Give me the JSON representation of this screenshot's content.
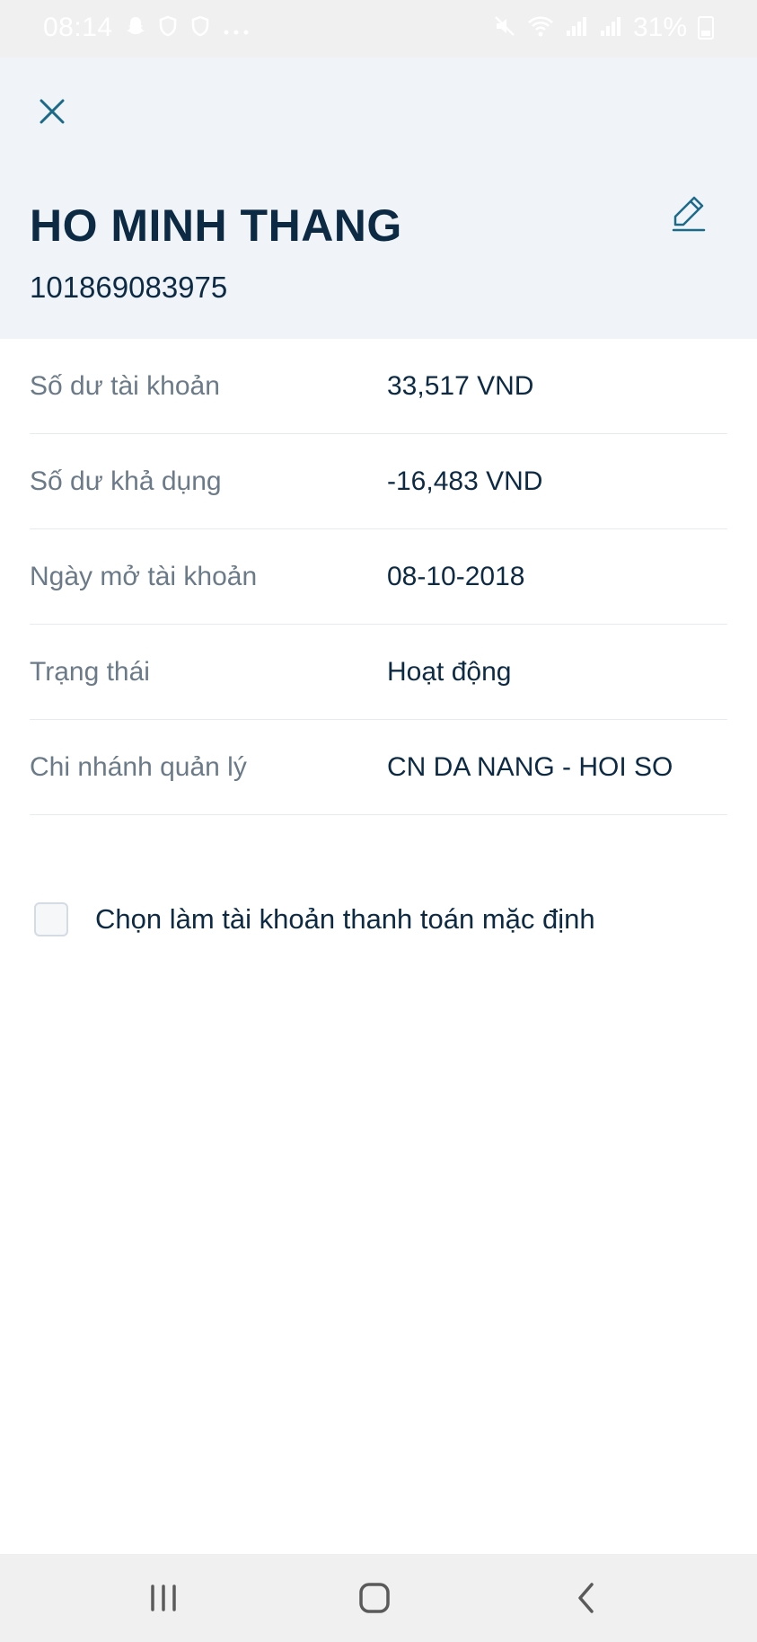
{
  "status_bar": {
    "time": "08:14",
    "battery": "31%",
    "left_icons": [
      "snapchat-icon",
      "shield-icon",
      "shield-icon",
      "more-dots-icon"
    ],
    "right_icons": [
      "mute-icon",
      "wifi-icon",
      "signal-icon",
      "signal-icon",
      "battery-icon"
    ]
  },
  "header": {
    "account_name": "HO MINH THANG",
    "account_number": "101869083975"
  },
  "details": [
    {
      "label": "Số dư tài khoản",
      "value": "33,517 VND"
    },
    {
      "label": "Số dư khả dụng",
      "value": "-16,483 VND"
    },
    {
      "label": "Ngày mở tài khoản",
      "value": "08-10-2018"
    },
    {
      "label": "Trạng thái",
      "value": "Hoạt động"
    },
    {
      "label": "Chi nhánh quản lý",
      "value": "CN DA NANG - HOI SO"
    }
  ],
  "default_account": {
    "label": "Chọn làm tài khoản thanh toán mặc định",
    "checked": false
  },
  "colors": {
    "primary_text": "#0d2a44",
    "secondary_text": "#6b7a88",
    "header_bg": "#f0f4f8",
    "accent": "#1b6a8a"
  }
}
